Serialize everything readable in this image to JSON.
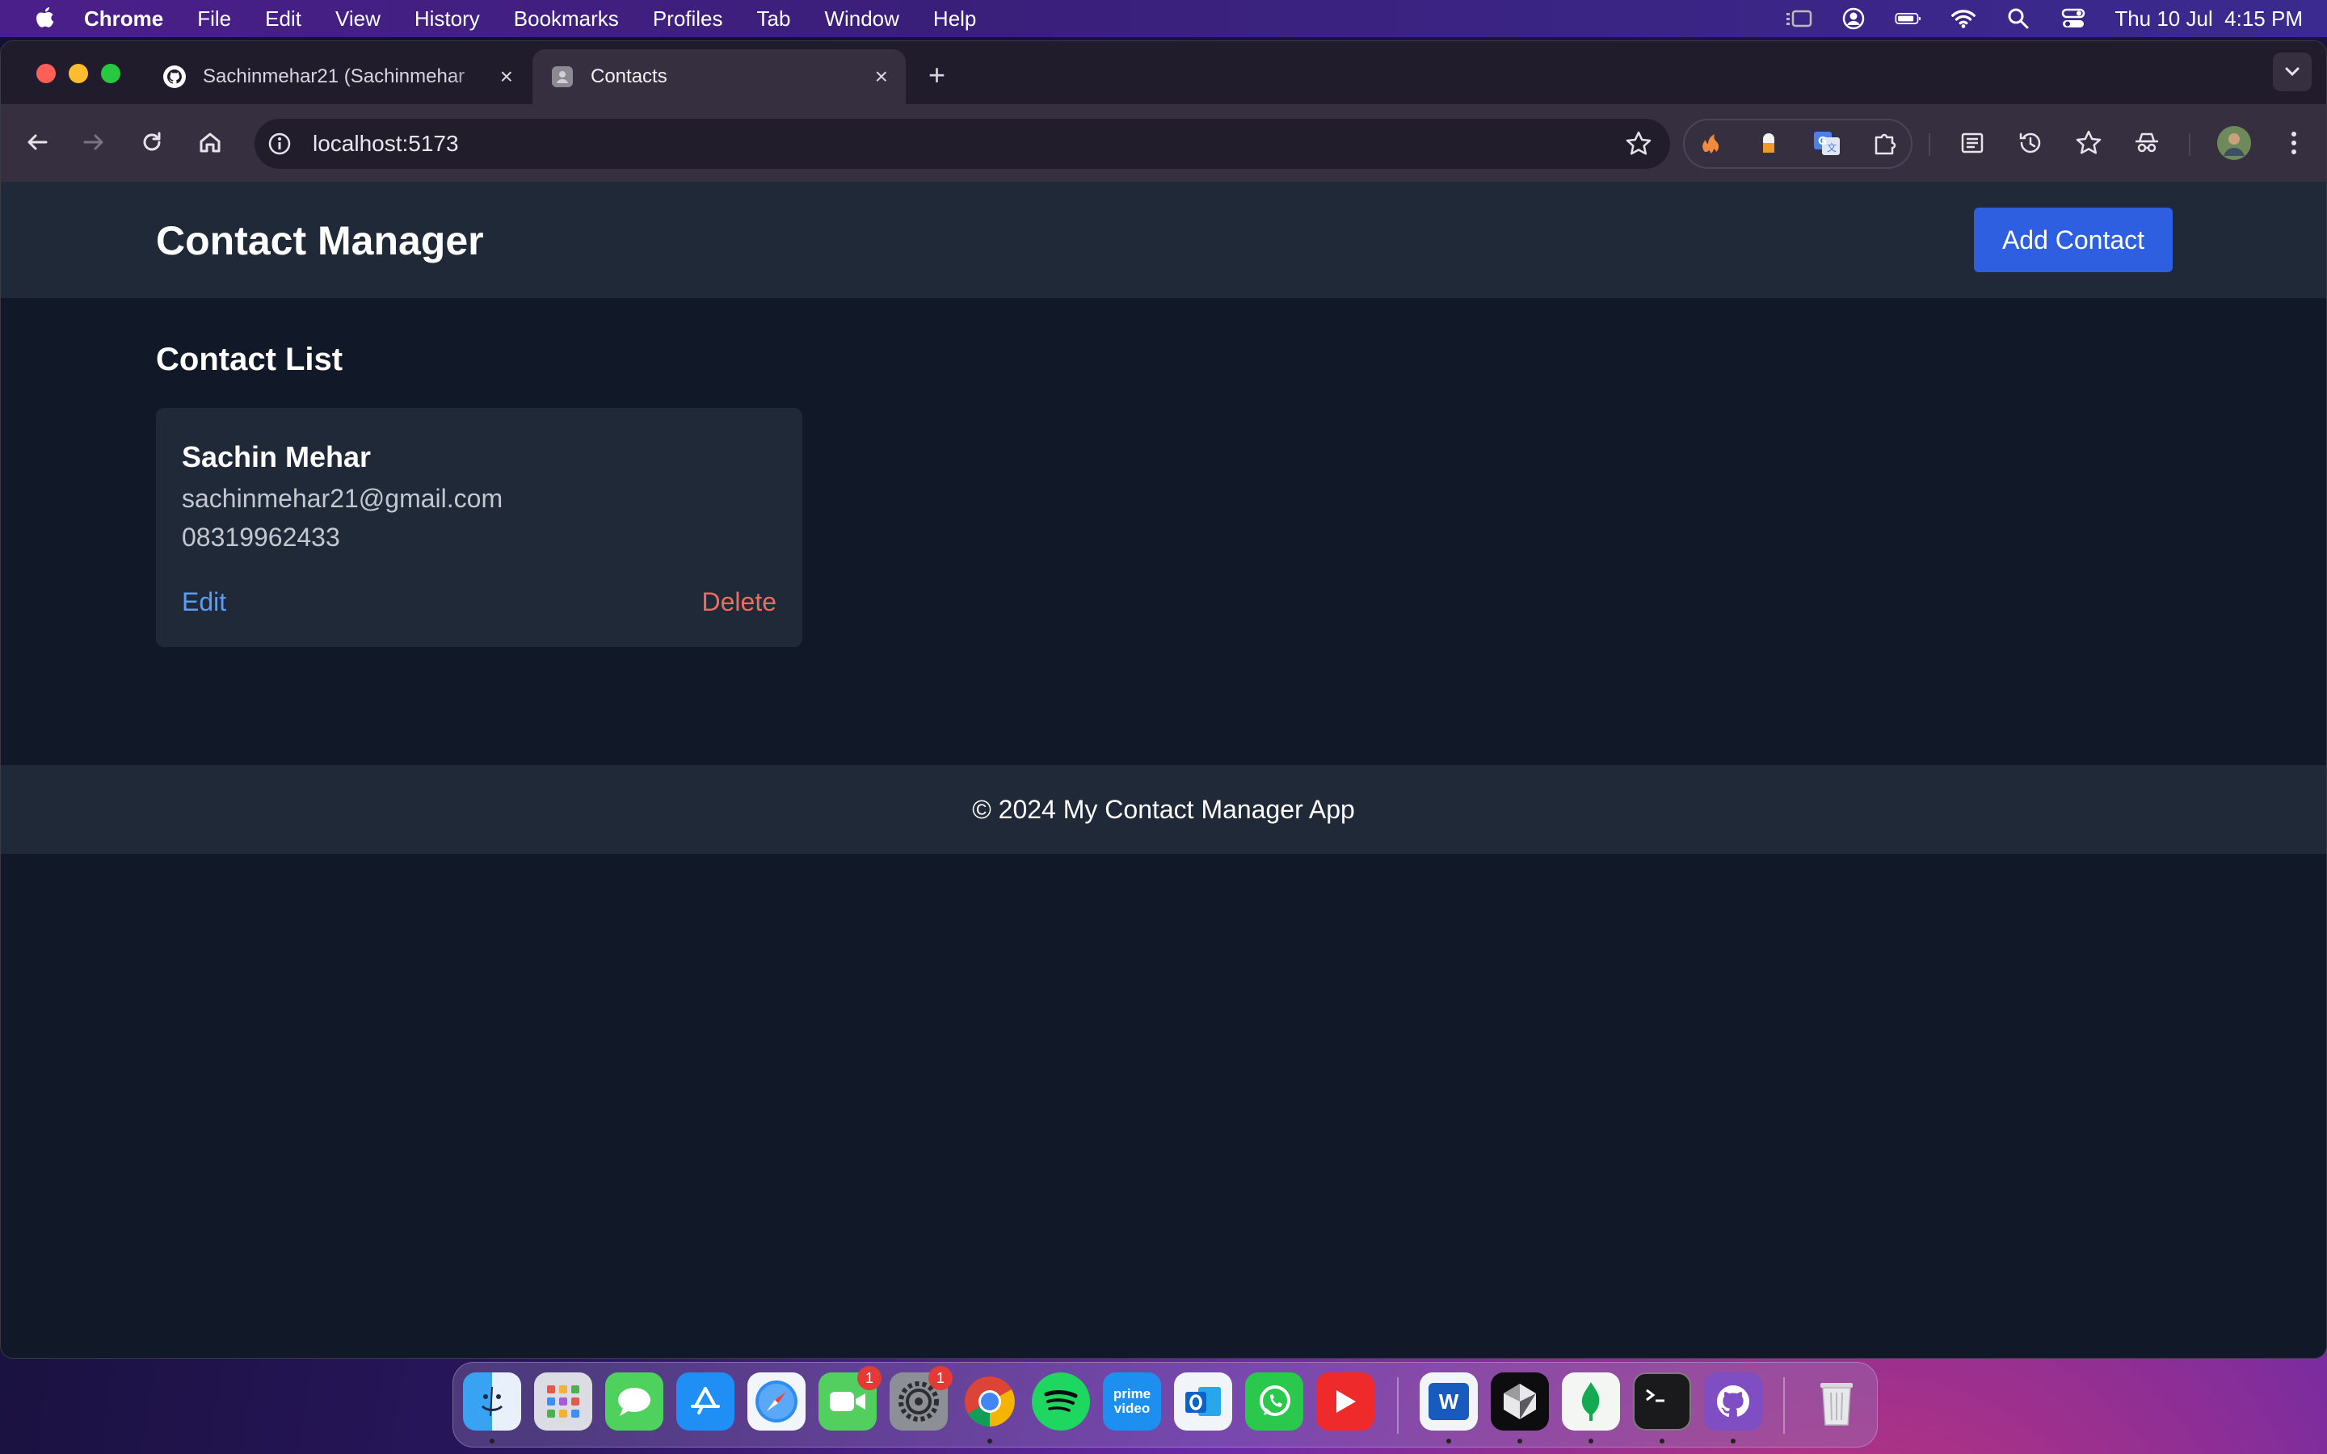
{
  "menubar": {
    "app": "Chrome",
    "items": [
      "File",
      "Edit",
      "View",
      "History",
      "Bookmarks",
      "Profiles",
      "Tab",
      "Window",
      "Help"
    ],
    "clock": "Thu 10 Jul  4:15 PM"
  },
  "tabs": [
    {
      "title": "Sachinmehar21 (Sachinmehar",
      "favicon": "github-icon"
    },
    {
      "title": "Contacts",
      "favicon": "page-icon"
    }
  ],
  "address_bar": {
    "url": "localhost:5173"
  },
  "app": {
    "title": "Contact Manager",
    "add_button": "Add Contact",
    "list_title": "Contact List",
    "contacts": [
      {
        "name": "Sachin Mehar",
        "email": "sachinmehar21@gmail.com",
        "phone": "08319962433",
        "edit_label": "Edit",
        "delete_label": "Delete"
      }
    ],
    "footer": "© 2024 My Contact Manager App"
  },
  "dock": {
    "apps": [
      "finder",
      "launchpad",
      "messages",
      "app-store",
      "safari",
      "facetime",
      "system-settings",
      "chrome",
      "spotify",
      "prime-video",
      "outlook",
      "whatsapp",
      "youtube",
      "word",
      "cursor",
      "mongodb-compass",
      "terminal",
      "github-desktop",
      "trash"
    ],
    "badges": {
      "facetime": "1",
      "system_settings": "1"
    },
    "prime_label": "prime video",
    "word_label": "W"
  },
  "colors": {
    "page_bg": "#111827",
    "surface": "#1f2937",
    "primary_button": "#2d5fe0",
    "edit_link": "#5e9cf2",
    "delete_link": "#ef6b61"
  }
}
